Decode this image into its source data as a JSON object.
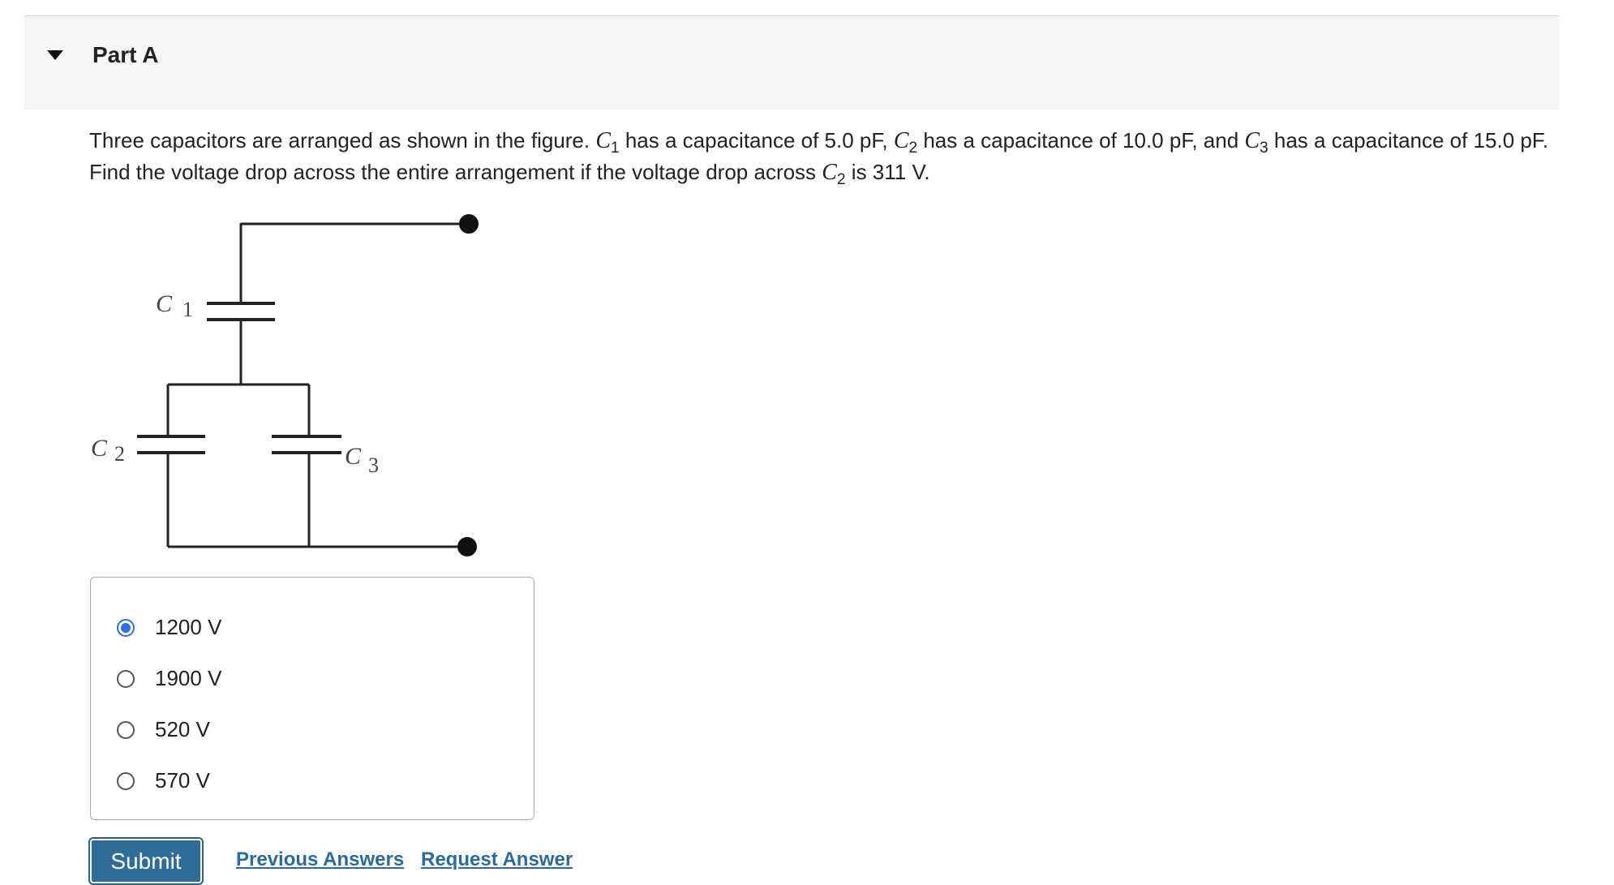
{
  "part": {
    "title": "Part A"
  },
  "question": {
    "t1": "Three capacitors are arranged as shown in the figure. ",
    "c1": "C",
    "c1_sub": "1",
    "t2": " has a capacitance of 5.0 pF, ",
    "c2": "C",
    "c2_sub": "2",
    "t3": " has a capacitance of 10.0 pF, and ",
    "c3": "C",
    "c3_sub": "3",
    "t4": " has a capacitance of 15.0 pF. Find the voltage drop across the entire arrangement if the voltage drop across ",
    "c4": "C",
    "c4_sub": "2",
    "t5": " is 311 V."
  },
  "figure": {
    "c1_label": "C",
    "c1_sub": "1",
    "c2_label": "C",
    "c2_sub": "2",
    "c3_label": "C",
    "c3_sub": "3"
  },
  "choices": [
    {
      "label": "1200 V",
      "selected": true
    },
    {
      "label": "1900 V",
      "selected": false
    },
    {
      "label": "520 V",
      "selected": false
    },
    {
      "label": "570 V",
      "selected": false
    }
  ],
  "actions": {
    "submit": "Submit",
    "previous_answers": "Previous Answers",
    "request_answer": "Request Answer"
  },
  "colors": {
    "accent": "#2f6fe4",
    "button": "#2f6d96",
    "link": "#2a6a9c"
  }
}
